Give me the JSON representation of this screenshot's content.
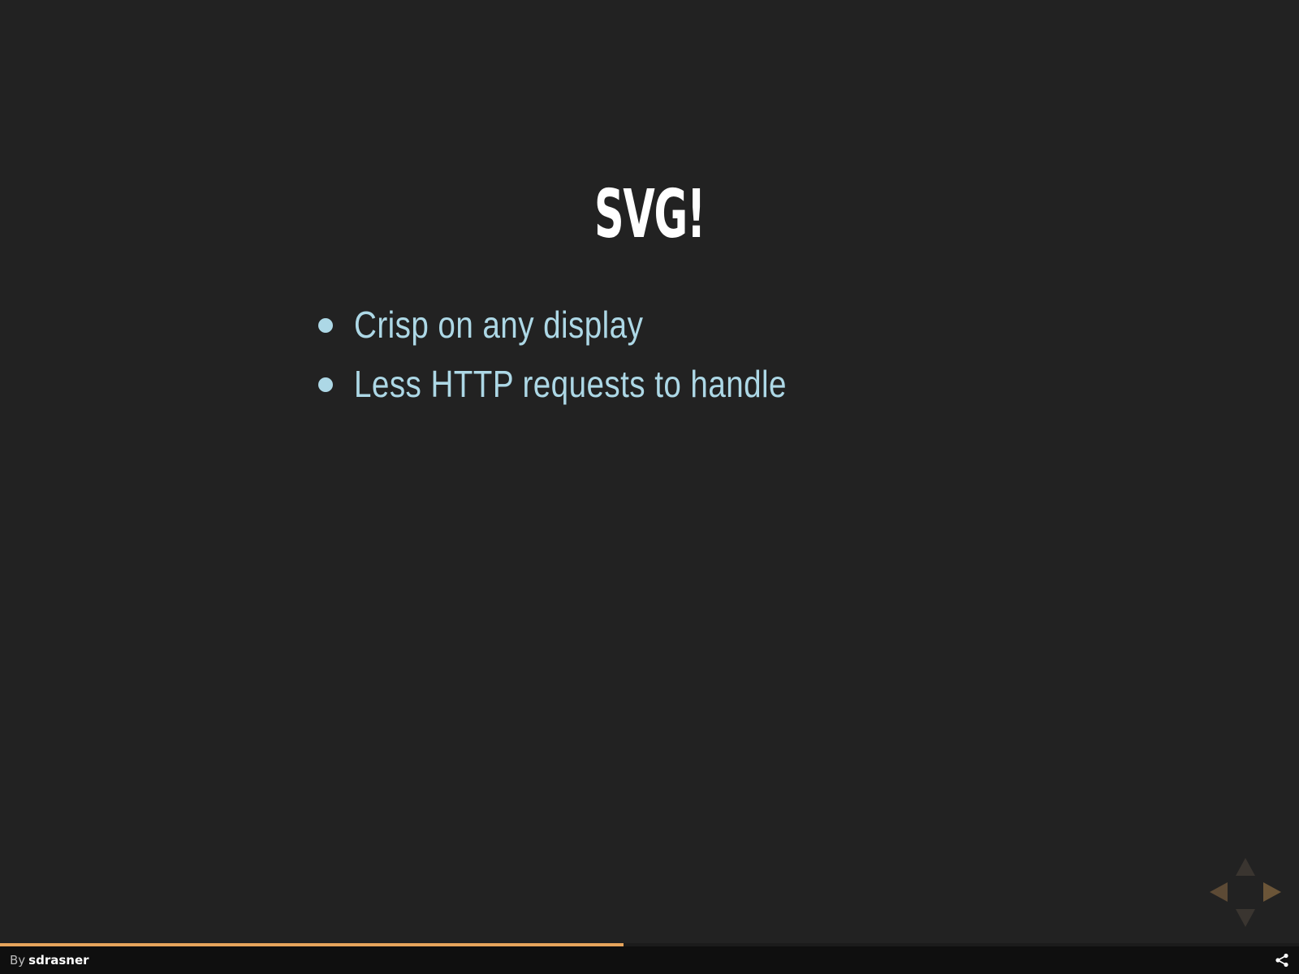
{
  "slide": {
    "title": "SVG!",
    "bullets": [
      "Crisp on any display",
      "Less HTTP requests to handle"
    ]
  },
  "progress": {
    "fraction": 0.48
  },
  "footer": {
    "by_prefix": "By",
    "author": "sdrasner"
  },
  "colors": {
    "background": "#222222",
    "title": "#ffffff",
    "bullet_text": "#add8e6",
    "progress_accent": "#e6a45c",
    "footer_bg": "#0f0f0f"
  },
  "icons": {
    "nav_up": "triangle-up-icon",
    "nav_down": "triangle-down-icon",
    "nav_left": "triangle-left-icon",
    "nav_right": "triangle-right-icon",
    "share": "share-icon"
  }
}
